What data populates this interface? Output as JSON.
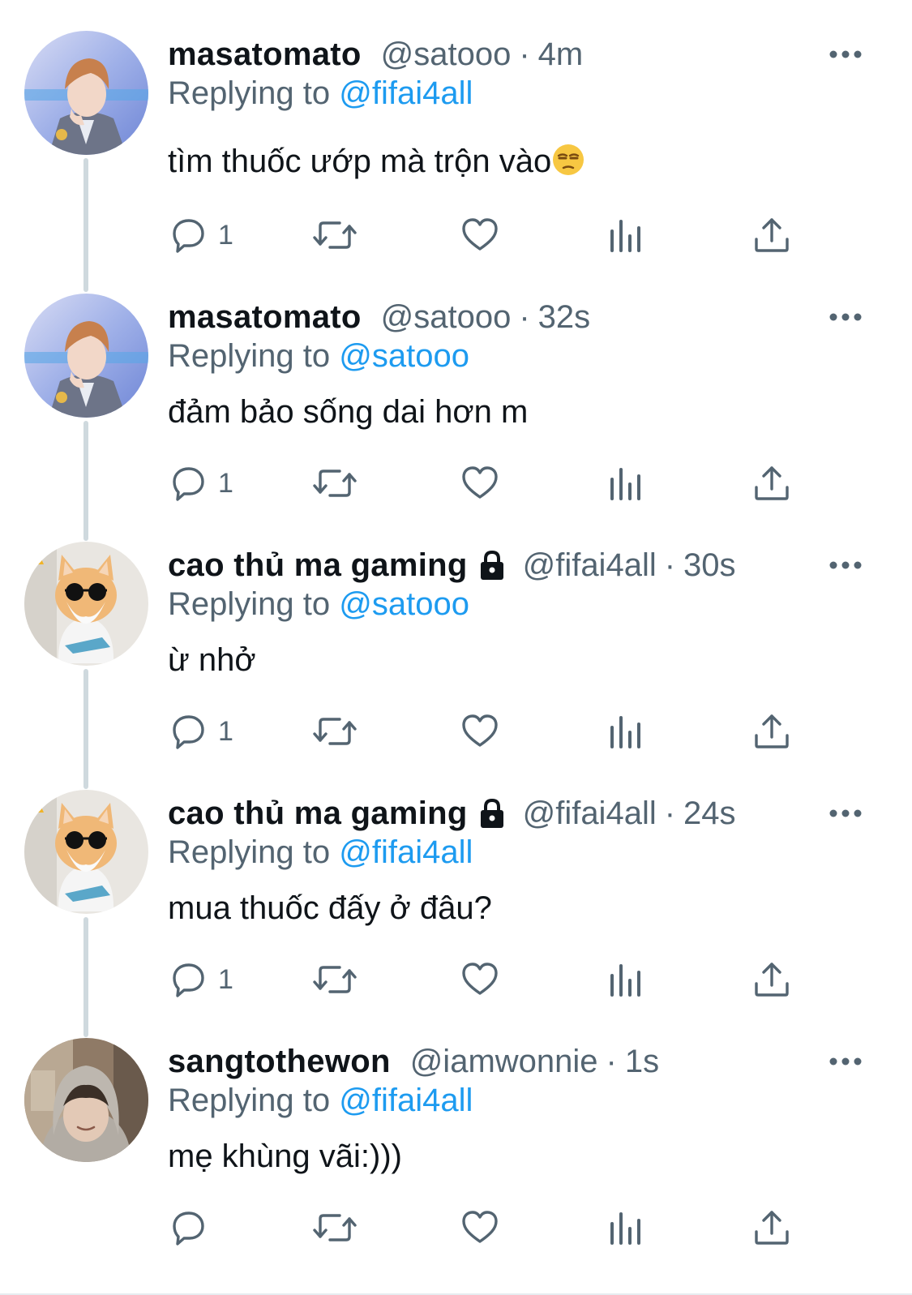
{
  "tweets": [
    {
      "display_name": "masatomato",
      "handle": "@satooo",
      "separator": "·",
      "time": "4m",
      "replying_prefix": "Replying to",
      "replying_to": "@fifai4all",
      "text": "tìm thuốc ướp mà trộn vào",
      "emoji": "unamused-face-icon",
      "reply_count": "1",
      "locked": false,
      "avatar": "person-portrait-icon"
    },
    {
      "display_name": "masatomato",
      "handle": "@satooo",
      "separator": "·",
      "time": "32s",
      "replying_prefix": "Replying to",
      "replying_to": "@satooo",
      "text": "đảm bảo sống dai hơn m",
      "reply_count": "1",
      "locked": false,
      "avatar": "person-portrait-icon"
    },
    {
      "display_name": "cao thủ ma gaming",
      "handle": "@fifai4all",
      "separator": "·",
      "time": "30s",
      "replying_prefix": "Replying to",
      "replying_to": "@satooo",
      "text": "ừ nhở",
      "reply_count": "1",
      "locked": true,
      "avatar": "cat-sunglasses-icon"
    },
    {
      "display_name": "cao thủ ma gaming",
      "handle": "@fifai4all",
      "separator": "·",
      "time": "24s",
      "replying_prefix": "Replying to",
      "replying_to": "@fifai4all",
      "text": "mua thuốc đấy ở đâu?",
      "reply_count": "1",
      "locked": true,
      "avatar": "cat-sunglasses-icon"
    },
    {
      "display_name": "sangtothewon",
      "handle": "@iamwonnie",
      "separator": "·",
      "time": "1s",
      "replying_prefix": "Replying to",
      "replying_to": "@fifai4all",
      "text": "mẹ khùng vãi:)))",
      "reply_count": "",
      "locked": false,
      "avatar": "hooded-person-icon"
    }
  ],
  "icons": {
    "more": "more-horizontal-icon",
    "reply": "reply-bubble-icon",
    "retweet": "retweet-icon",
    "like": "heart-icon",
    "views": "analytics-icon",
    "share": "share-icon",
    "lock": "lock-icon"
  },
  "colors": {
    "accent": "#1d9bf0",
    "secondary_text": "#536471",
    "primary_text": "#0f1419",
    "thread_line": "#cfd9de"
  }
}
